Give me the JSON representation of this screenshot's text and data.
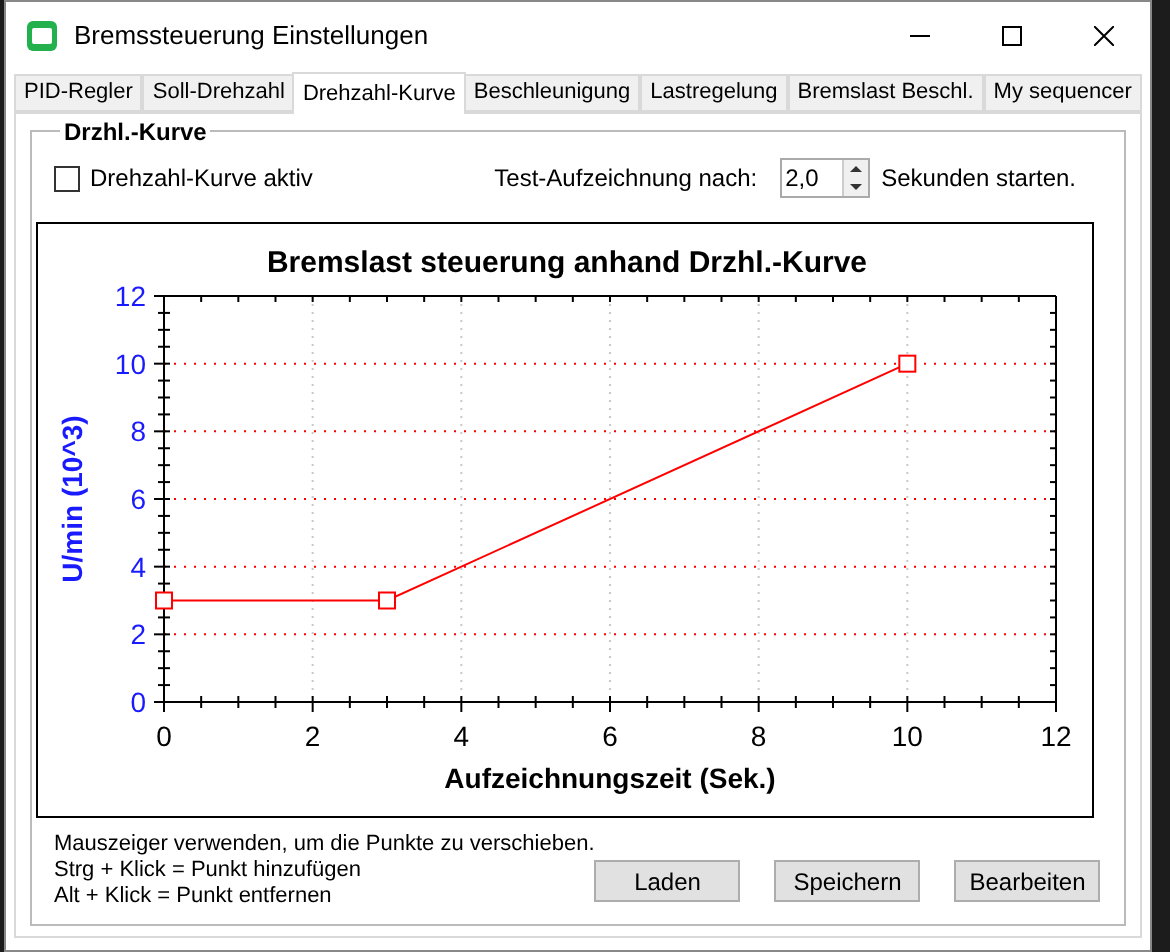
{
  "window": {
    "title": "Bremssteuerung Einstellungen"
  },
  "tabs": [
    {
      "label": "PID-Regler",
      "selected": false
    },
    {
      "label": "Soll-Drehzahl",
      "selected": false
    },
    {
      "label": "Drehzahl-Kurve",
      "selected": true
    },
    {
      "label": "Beschleunigung",
      "selected": false
    },
    {
      "label": "Lastregelung",
      "selected": false
    },
    {
      "label": "Bremslast Beschl.",
      "selected": false
    },
    {
      "label": "My sequencer",
      "selected": false
    }
  ],
  "group": {
    "title": "Drzhl.-Kurve",
    "checkbox": {
      "label": "Drehzahl-Kurve aktiv",
      "checked": false
    },
    "test": {
      "label": "Test-Aufzeichnung nach:",
      "value": "2,0",
      "suffix": "Sekunden starten."
    },
    "chart_data": {
      "type": "line",
      "title": "Bremslast steuerung anhand Drzhl.-Kurve",
      "xlabel": "Aufzeichnungszeit (Sek.)",
      "ylabel": "U/min (10^3)",
      "x": [
        0,
        3,
        10
      ],
      "series": [
        {
          "color": "#ff0000",
          "marker": "square",
          "values": [
            3,
            3,
            10
          ]
        }
      ],
      "grid": true,
      "xlim": [
        0,
        12
      ],
      "ylim": [
        0,
        12
      ],
      "xticks": [
        0,
        2,
        4,
        6,
        8,
        10,
        12
      ],
      "yticks": [
        0,
        2,
        4,
        6,
        8,
        10,
        12
      ]
    },
    "help": [
      "Mauszeiger verwenden, um die Punkte zu verschieben.",
      "Strg + Klick = Punkt hinzufügen",
      "Alt + Klick = Punkt entfernen"
    ],
    "buttons": [
      "Laden",
      "Speichern",
      "Bearbeiten"
    ]
  }
}
